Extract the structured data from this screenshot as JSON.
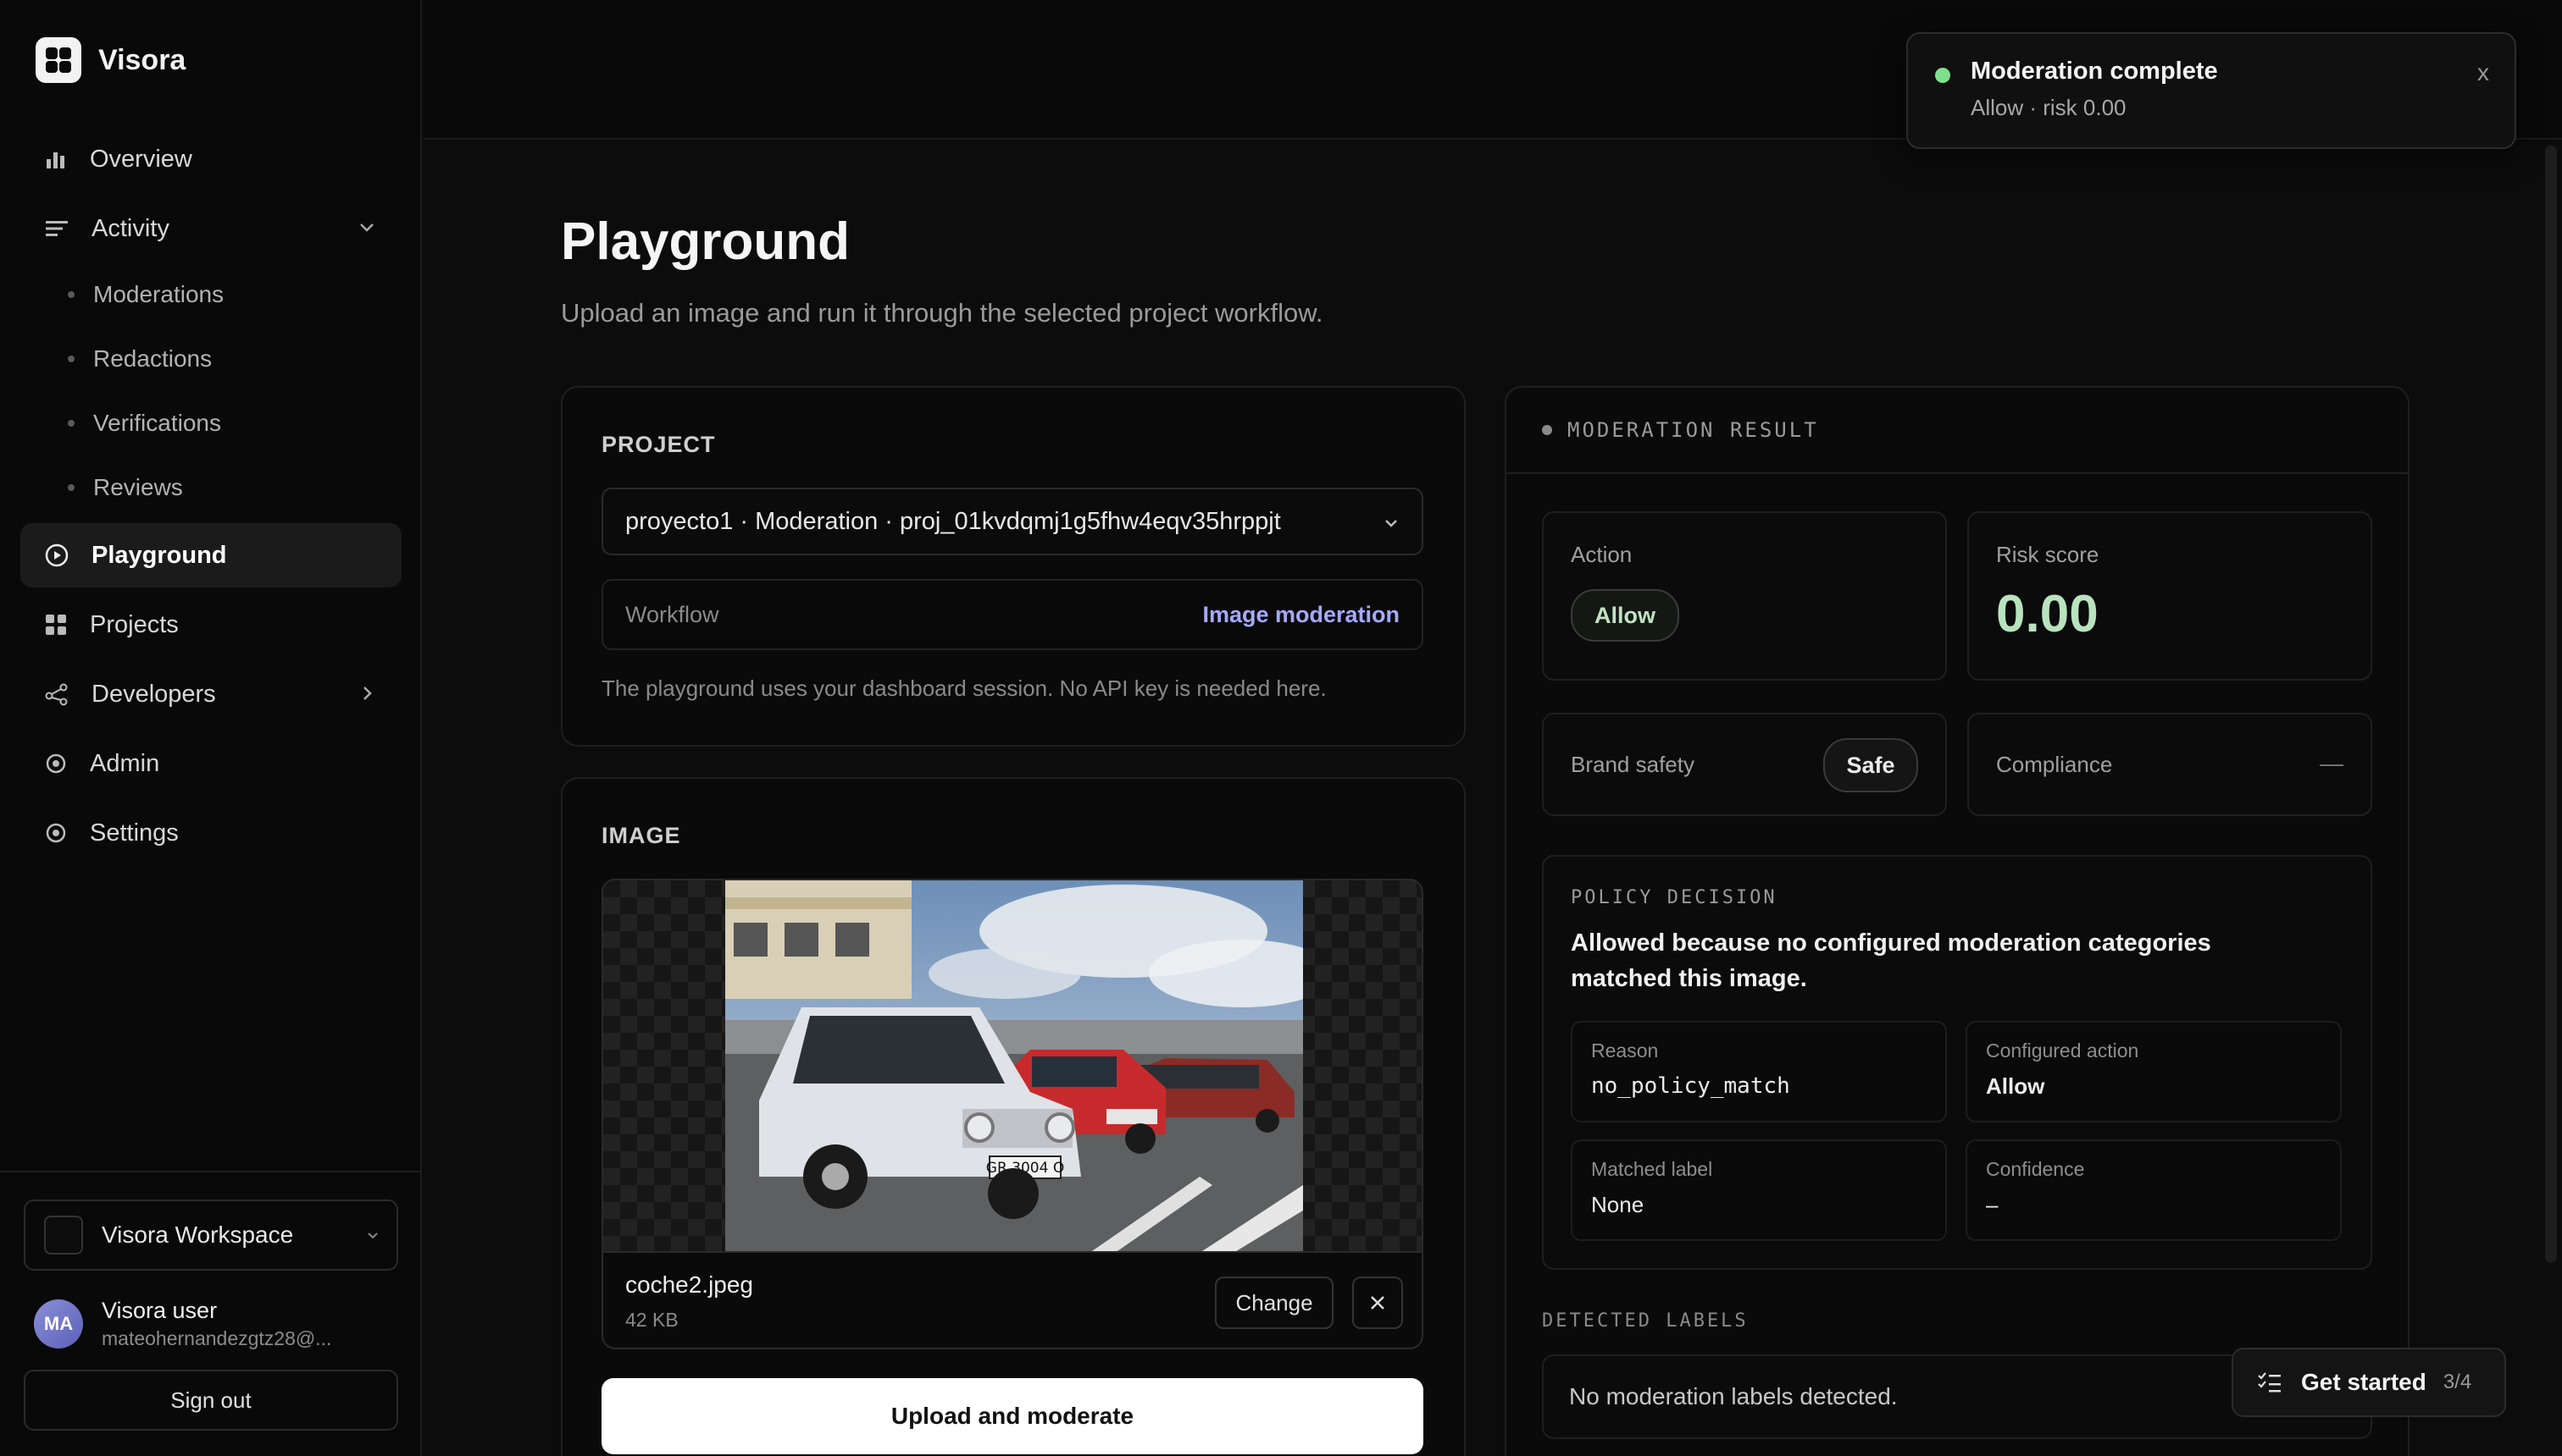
{
  "app": {
    "name": "Visora"
  },
  "sidebar": {
    "nav": [
      {
        "label": "Overview",
        "icon": "bar-chart-icon"
      },
      {
        "label": "Activity",
        "icon": "list-icon",
        "expanded": true
      },
      {
        "label": "Playground",
        "icon": "play-circle-icon",
        "active": true
      },
      {
        "label": "Projects",
        "icon": "grid-icon"
      },
      {
        "label": "Developers",
        "icon": "share-nodes-icon"
      },
      {
        "label": "Admin",
        "icon": "target-icon"
      },
      {
        "label": "Settings",
        "icon": "gear-icon"
      }
    ],
    "activity_children": [
      "Moderations",
      "Redactions",
      "Verifications",
      "Reviews"
    ],
    "workspace": "Visora Workspace",
    "user": {
      "initials": "MA",
      "name": "Visora user",
      "email": "mateohernandezgtz28@..."
    },
    "sign_out": "Sign out"
  },
  "page": {
    "title": "Playground",
    "subtitle": "Upload an image and run it through the selected project workflow."
  },
  "project": {
    "section_label": "PROJECT",
    "selected": "proyecto1 · Moderation · proj_01kvdqmj1g5fhw4eqv35hrppjt",
    "workflow_label": "Workflow",
    "workflow_value": "Image moderation",
    "hint": "The playground uses your dashboard session. No API key is needed here."
  },
  "image": {
    "section_label": "IMAGE",
    "file_name": "coche2.jpeg",
    "file_size": "42 KB",
    "change_label": "Change",
    "plate_text": "GR 3004 O"
  },
  "upload_button": "Upload and moderate",
  "result": {
    "header": "MODERATION RESULT",
    "action_label": "Action",
    "action_value": "Allow",
    "risk_label": "Risk score",
    "risk_value": "0.00",
    "brand_safety_label": "Brand safety",
    "brand_safety_value": "Safe",
    "compliance_label": "Compliance",
    "compliance_value": "—",
    "policy_title": "POLICY DECISION",
    "policy_text": "Allowed because no configured moderation categories matched this image.",
    "reason_label": "Reason",
    "reason_value": "no_policy_match",
    "configured_action_label": "Configured action",
    "configured_action_value": "Allow",
    "matched_label_label": "Matched label",
    "matched_label_value": "None",
    "confidence_label": "Confidence",
    "confidence_value": "–",
    "detected_title": "DETECTED LABELS",
    "detected_empty": "No moderation labels detected."
  },
  "toast": {
    "title": "Moderation complete",
    "subtitle": "Allow · risk 0.00",
    "close": "x"
  },
  "get_started": {
    "label": "Get started",
    "count": "3/4"
  },
  "colors": {
    "background": "#0a0a0a",
    "accent_link": "#a5a9ff",
    "success": "#7ee08a",
    "risk": "#b9e3bf"
  }
}
